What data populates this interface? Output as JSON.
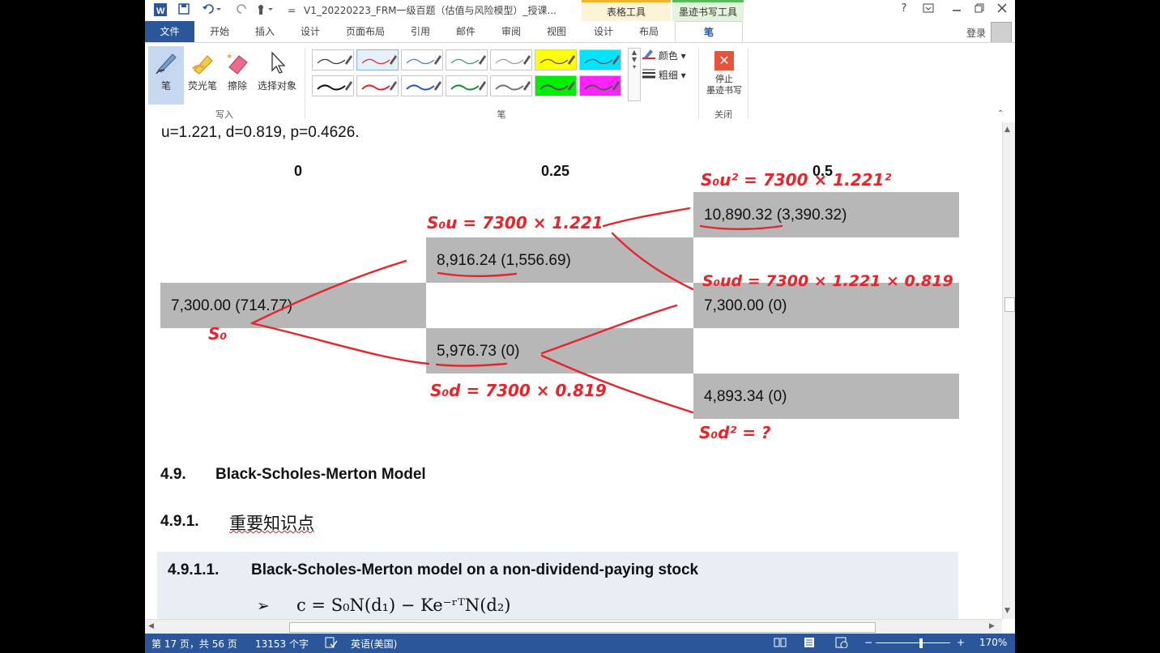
{
  "titlebar": {
    "doc_title": "V1_20220223_FRM一级百题（估值与风险模型）_授课...",
    "ctx_table_tools": "表格工具",
    "ctx_ink_tools": "墨迹书写工具",
    "help": "?",
    "quick_access_separator": "="
  },
  "tabs": [
    "文件",
    "开始",
    "插入",
    "设计",
    "页面布局",
    "引用",
    "邮件",
    "审阅",
    "视图",
    "设计",
    "布局",
    "笔"
  ],
  "login": "登录",
  "ribbon": {
    "write_tools": [
      "笔",
      "荧光笔",
      "擦除",
      "选择对象"
    ],
    "write_group": "写入",
    "pen_group": "笔",
    "color": "颜色",
    "thickness": "粗细",
    "stop_label_1": "停止",
    "stop_label_2": "墨迹书写",
    "close_group": "关闭"
  },
  "document": {
    "params": "u=1.221, d=0.819, p=0.4626.",
    "col_headers": [
      "0",
      "0.25",
      "0.5"
    ],
    "nodes": {
      "n0": "7,300.00 (714.77)",
      "n1u": "8,916.24 (1,556.69)",
      "n1d": "5,976.73 (0)",
      "n2uu": "10,890.32 (3,390.32)",
      "n2ud": "7,300.00 (0)",
      "n2dd": "4,893.34 (0)"
    },
    "section_num": "4.9.",
    "section_title": "Black-Scholes-Merton Model",
    "sub_num": "4.9.1.",
    "sub_title": "重要知识点",
    "subsub_num": "4.9.1.1.",
    "subsub_title": "Black-Scholes-Merton model on a non-dividend-paying stock",
    "bullet": "➢",
    "formula": "c = S₀N(d₁) − Ke⁻ʳᵀN(d₂)"
  },
  "annotations": {
    "s0": "S₀",
    "s0u": "S₀u = 7300 × 1.221",
    "s0d": "S₀d = 7300 × 0.819",
    "s0u2": "S₀u² = 7300 × 1.221²",
    "s0ud": "S₀ud = 7300 × 1.221 × 0.819",
    "s0d2": "S₀d² = ?",
    "ink_color": "#e8242b"
  },
  "status": {
    "page": "第 17 页，共 56 页",
    "words": "13153 个字",
    "language": "英语(美国)",
    "zoom": "170%"
  }
}
